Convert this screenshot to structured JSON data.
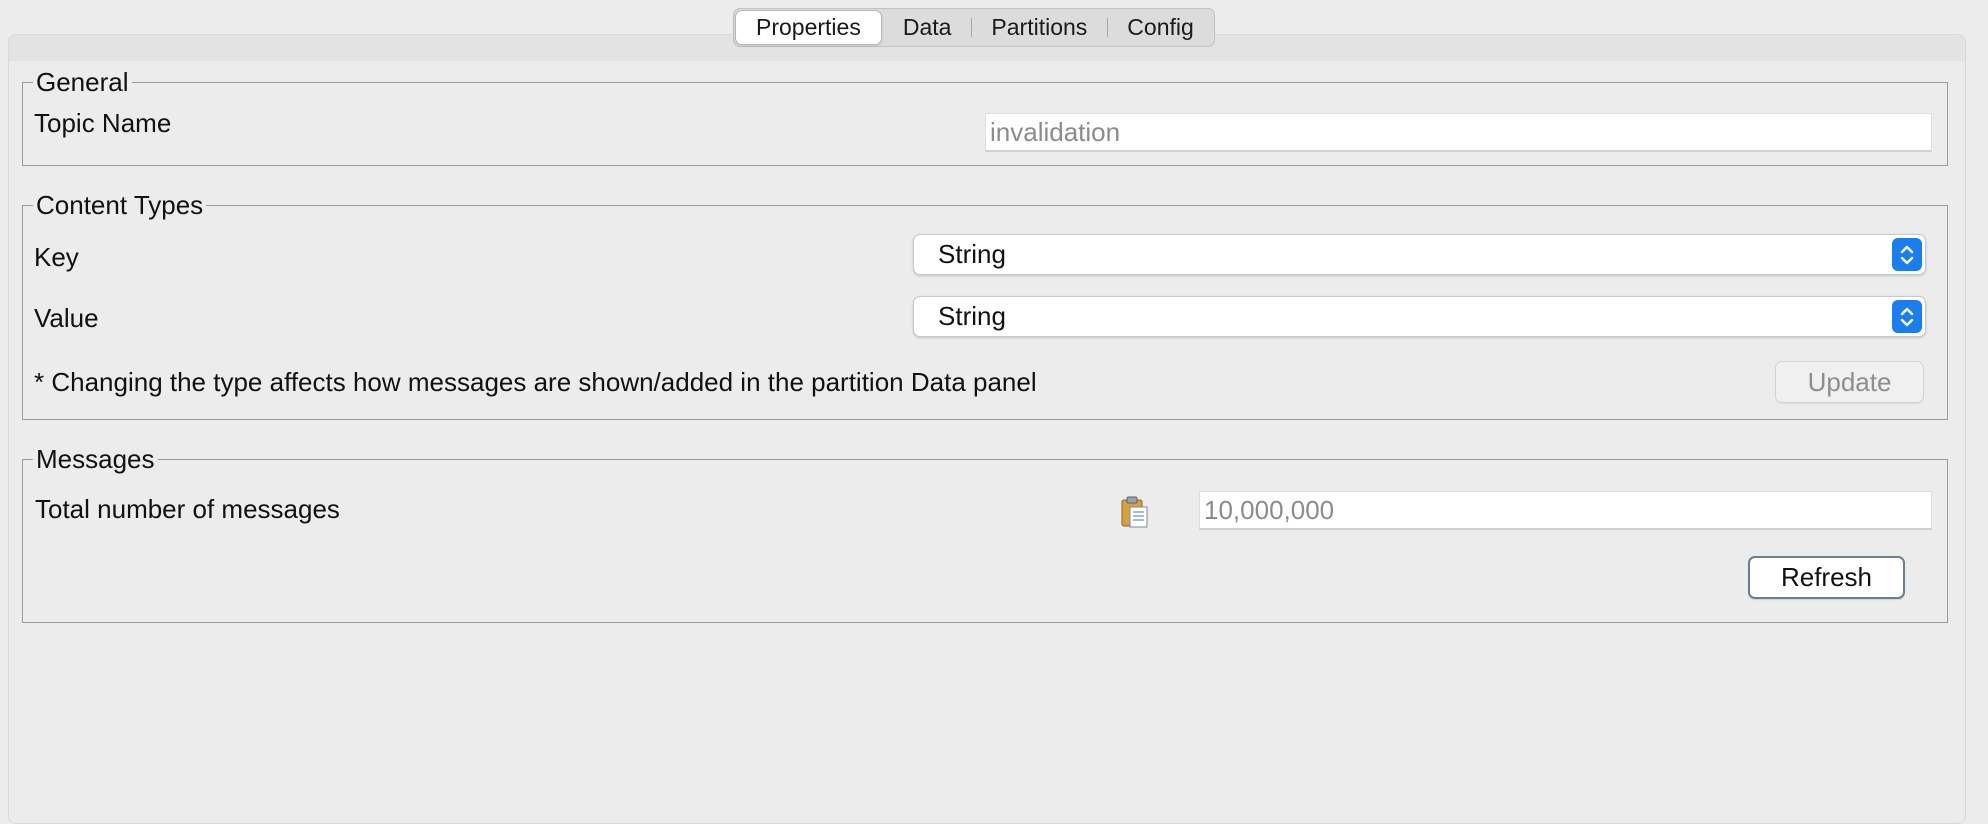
{
  "tabs": [
    {
      "label": "Properties",
      "active": true
    },
    {
      "label": "Data",
      "active": false
    },
    {
      "label": "Partitions",
      "active": false
    },
    {
      "label": "Config",
      "active": false
    }
  ],
  "general": {
    "legend": "General",
    "topic_name_label": "Topic Name",
    "topic_name_value": "invalidation"
  },
  "content_types": {
    "legend": "Content Types",
    "key_label": "Key",
    "key_value": "String",
    "value_label": "Value",
    "value_value": "String",
    "note": "* Changing the type affects how messages are shown/added in the partition Data panel",
    "update_label": "Update"
  },
  "messages": {
    "legend": "Messages",
    "total_label": "Total number of messages",
    "total_value": "10,000,000",
    "refresh_label": "Refresh"
  },
  "colors": {
    "accent": "#1a7df0",
    "background": "#ececec"
  },
  "icons": {
    "copy": "clipboard-icon",
    "select_arrows": "chevron-up-down-icon"
  }
}
